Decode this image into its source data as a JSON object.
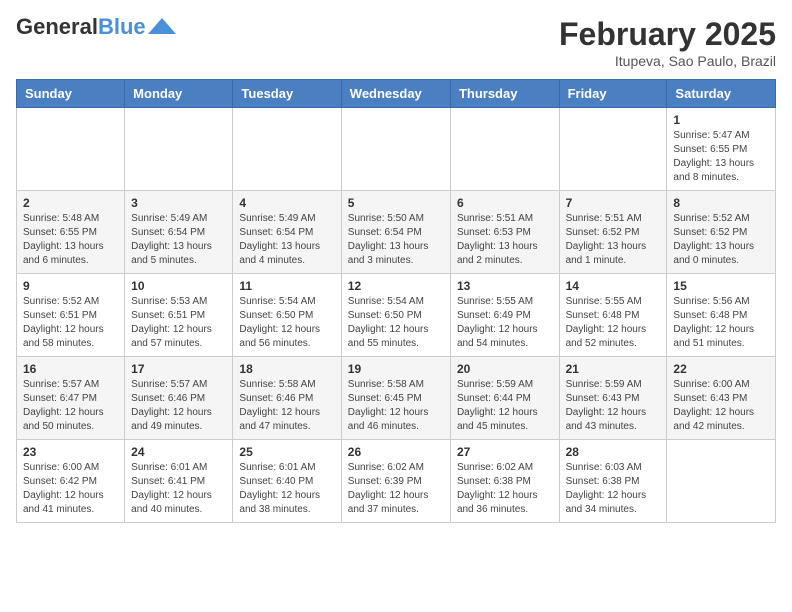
{
  "header": {
    "logo_general": "General",
    "logo_blue": "Blue",
    "title": "February 2025",
    "subtitle": "Itupeva, Sao Paulo, Brazil"
  },
  "days_of_week": [
    "Sunday",
    "Monday",
    "Tuesday",
    "Wednesday",
    "Thursday",
    "Friday",
    "Saturday"
  ],
  "weeks": [
    [
      {
        "day": "",
        "info": ""
      },
      {
        "day": "",
        "info": ""
      },
      {
        "day": "",
        "info": ""
      },
      {
        "day": "",
        "info": ""
      },
      {
        "day": "",
        "info": ""
      },
      {
        "day": "",
        "info": ""
      },
      {
        "day": "1",
        "info": "Sunrise: 5:47 AM\nSunset: 6:55 PM\nDaylight: 13 hours and 8 minutes."
      }
    ],
    [
      {
        "day": "2",
        "info": "Sunrise: 5:48 AM\nSunset: 6:55 PM\nDaylight: 13 hours and 6 minutes."
      },
      {
        "day": "3",
        "info": "Sunrise: 5:49 AM\nSunset: 6:54 PM\nDaylight: 13 hours and 5 minutes."
      },
      {
        "day": "4",
        "info": "Sunrise: 5:49 AM\nSunset: 6:54 PM\nDaylight: 13 hours and 4 minutes."
      },
      {
        "day": "5",
        "info": "Sunrise: 5:50 AM\nSunset: 6:54 PM\nDaylight: 13 hours and 3 minutes."
      },
      {
        "day": "6",
        "info": "Sunrise: 5:51 AM\nSunset: 6:53 PM\nDaylight: 13 hours and 2 minutes."
      },
      {
        "day": "7",
        "info": "Sunrise: 5:51 AM\nSunset: 6:52 PM\nDaylight: 13 hours and 1 minute."
      },
      {
        "day": "8",
        "info": "Sunrise: 5:52 AM\nSunset: 6:52 PM\nDaylight: 13 hours and 0 minutes."
      }
    ],
    [
      {
        "day": "9",
        "info": "Sunrise: 5:52 AM\nSunset: 6:51 PM\nDaylight: 12 hours and 58 minutes."
      },
      {
        "day": "10",
        "info": "Sunrise: 5:53 AM\nSunset: 6:51 PM\nDaylight: 12 hours and 57 minutes."
      },
      {
        "day": "11",
        "info": "Sunrise: 5:54 AM\nSunset: 6:50 PM\nDaylight: 12 hours and 56 minutes."
      },
      {
        "day": "12",
        "info": "Sunrise: 5:54 AM\nSunset: 6:50 PM\nDaylight: 12 hours and 55 minutes."
      },
      {
        "day": "13",
        "info": "Sunrise: 5:55 AM\nSunset: 6:49 PM\nDaylight: 12 hours and 54 minutes."
      },
      {
        "day": "14",
        "info": "Sunrise: 5:55 AM\nSunset: 6:48 PM\nDaylight: 12 hours and 52 minutes."
      },
      {
        "day": "15",
        "info": "Sunrise: 5:56 AM\nSunset: 6:48 PM\nDaylight: 12 hours and 51 minutes."
      }
    ],
    [
      {
        "day": "16",
        "info": "Sunrise: 5:57 AM\nSunset: 6:47 PM\nDaylight: 12 hours and 50 minutes."
      },
      {
        "day": "17",
        "info": "Sunrise: 5:57 AM\nSunset: 6:46 PM\nDaylight: 12 hours and 49 minutes."
      },
      {
        "day": "18",
        "info": "Sunrise: 5:58 AM\nSunset: 6:46 PM\nDaylight: 12 hours and 47 minutes."
      },
      {
        "day": "19",
        "info": "Sunrise: 5:58 AM\nSunset: 6:45 PM\nDaylight: 12 hours and 46 minutes."
      },
      {
        "day": "20",
        "info": "Sunrise: 5:59 AM\nSunset: 6:44 PM\nDaylight: 12 hours and 45 minutes."
      },
      {
        "day": "21",
        "info": "Sunrise: 5:59 AM\nSunset: 6:43 PM\nDaylight: 12 hours and 43 minutes."
      },
      {
        "day": "22",
        "info": "Sunrise: 6:00 AM\nSunset: 6:43 PM\nDaylight: 12 hours and 42 minutes."
      }
    ],
    [
      {
        "day": "23",
        "info": "Sunrise: 6:00 AM\nSunset: 6:42 PM\nDaylight: 12 hours and 41 minutes."
      },
      {
        "day": "24",
        "info": "Sunrise: 6:01 AM\nSunset: 6:41 PM\nDaylight: 12 hours and 40 minutes."
      },
      {
        "day": "25",
        "info": "Sunrise: 6:01 AM\nSunset: 6:40 PM\nDaylight: 12 hours and 38 minutes."
      },
      {
        "day": "26",
        "info": "Sunrise: 6:02 AM\nSunset: 6:39 PM\nDaylight: 12 hours and 37 minutes."
      },
      {
        "day": "27",
        "info": "Sunrise: 6:02 AM\nSunset: 6:38 PM\nDaylight: 12 hours and 36 minutes."
      },
      {
        "day": "28",
        "info": "Sunrise: 6:03 AM\nSunset: 6:38 PM\nDaylight: 12 hours and 34 minutes."
      },
      {
        "day": "",
        "info": ""
      }
    ]
  ]
}
